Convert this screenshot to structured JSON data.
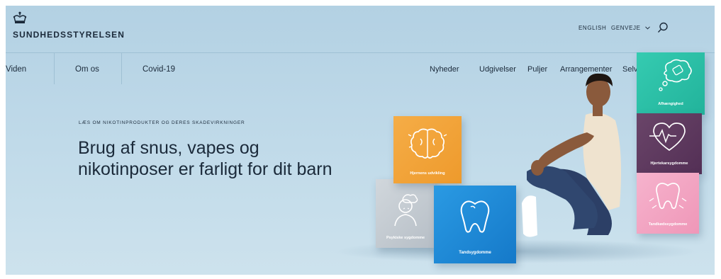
{
  "brand": {
    "name": "SUNDHEDSSTYRELSEN"
  },
  "utility": {
    "english": "ENGLISH",
    "genveje": "GENVEJE"
  },
  "icons": {
    "search": "search-icon",
    "crown": "crown-logo-icon",
    "dropdown": "chevron-down-icon"
  },
  "nav": {
    "primary": [
      "Viden",
      "Om os",
      "Covid-19"
    ],
    "secondary": [
      "Nyheder",
      "Udgivelser",
      "Puljer",
      "Arrangementer",
      "Selvbetjening"
    ]
  },
  "hero": {
    "kicker": "LÆS OM NIKOTINPRODUKTER OG DERES SKADEVIRKNINGER",
    "headline_line1": "Brug af snus, vapes og",
    "headline_line2": "nikotinposer er farligt for dit barn"
  },
  "boxes": {
    "brain": "Hjernens udvikling",
    "mental": "Psykiske sygdomme",
    "teeth": "Tandsygdomme",
    "addiction": "Afhængighed",
    "heart": "Hjertekarsygdomme",
    "gum": "Tandkødssygdomme"
  },
  "colors": {
    "background": "#bdd8e8",
    "text": "#1b2a3a",
    "box_orange": "#f2a33a",
    "box_grey": "#c5ccd2",
    "box_blue": "#1e8fdc",
    "box_teal": "#2cc3a9",
    "box_purple": "#5e3b60",
    "box_pink": "#f3a8c4"
  }
}
